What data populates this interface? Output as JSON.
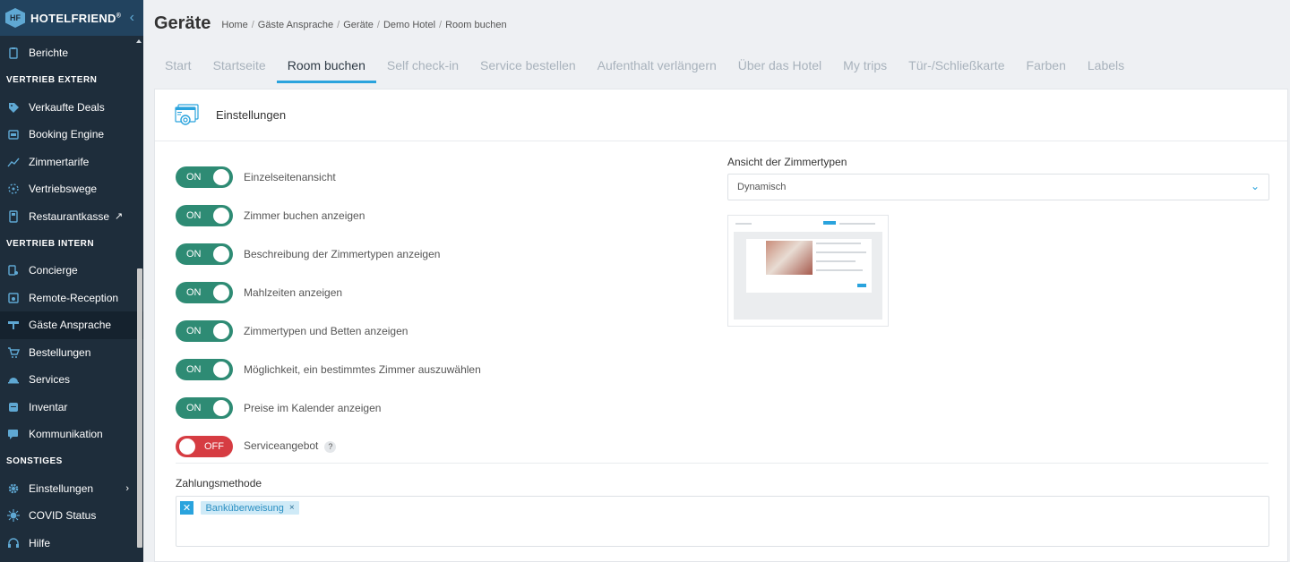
{
  "brand": {
    "name": "HOTELFRIEND",
    "trademark": "®",
    "logo_text": "HF"
  },
  "sidebar": {
    "top_items": [
      {
        "label": "Berichte",
        "icon": "clipboard-icon"
      }
    ],
    "sections": [
      {
        "title": "VERTRIEB EXTERN",
        "items": [
          {
            "label": "Verkaufte Deals",
            "icon": "tag-icon"
          },
          {
            "label": "Booking Engine",
            "icon": "booking-icon"
          },
          {
            "label": "Zimmertarife",
            "icon": "chart-line-icon"
          },
          {
            "label": "Vertriebswege",
            "icon": "channels-icon"
          },
          {
            "label": "Restaurantkasse",
            "icon": "pos-icon",
            "external": true
          }
        ]
      },
      {
        "title": "VERTRIEB INTERN",
        "items": [
          {
            "label": "Concierge",
            "icon": "concierge-icon"
          },
          {
            "label": "Remote-Reception",
            "icon": "reception-icon"
          },
          {
            "label": "Gäste Ansprache",
            "icon": "guest-icon",
            "active": true
          },
          {
            "label": "Bestellungen",
            "icon": "cart-icon"
          },
          {
            "label": "Services",
            "icon": "cloche-icon"
          },
          {
            "label": "Inventar",
            "icon": "inventory-icon"
          },
          {
            "label": "Kommunikation",
            "icon": "chat-icon"
          }
        ]
      },
      {
        "title": "SONSTIGES",
        "items": [
          {
            "label": "Einstellungen",
            "icon": "gear-icon",
            "has_submenu": true
          },
          {
            "label": "COVID Status",
            "icon": "virus-icon"
          },
          {
            "label": "Hilfe",
            "icon": "headset-icon"
          }
        ]
      }
    ]
  },
  "header": {
    "title": "Geräte",
    "breadcrumb": [
      "Home",
      "Gäste Ansprache",
      "Geräte",
      "Demo Hotel",
      "Room buchen"
    ]
  },
  "tabs": [
    "Start",
    "Startseite",
    "Room buchen",
    "Self check-in",
    "Service bestellen",
    "Aufenthalt verlängern",
    "Über das Hotel",
    "My trips",
    "Tür-/Schließkarte",
    "Farben",
    "Labels"
  ],
  "active_tab": "Room buchen",
  "panel": {
    "title": "Einstellungen",
    "toggles": [
      {
        "label": "Einzelseitenansicht",
        "state": "ON"
      },
      {
        "label": "Zimmer buchen anzeigen",
        "state": "ON"
      },
      {
        "label": "Beschreibung der Zimmertypen anzeigen",
        "state": "ON"
      },
      {
        "label": "Mahlzeiten anzeigen",
        "state": "ON"
      },
      {
        "label": "Zimmertypen und Betten anzeigen",
        "state": "ON"
      },
      {
        "label": "Möglichkeit, ein bestimmtes Zimmer auszuwählen",
        "state": "ON"
      },
      {
        "label": "Preise im Kalender anzeigen",
        "state": "ON"
      },
      {
        "label": "Serviceangebot",
        "state": "OFF",
        "help": "?"
      }
    ],
    "room_view": {
      "label": "Ansicht der Zimmertypen",
      "value": "Dynamisch"
    },
    "payment": {
      "label": "Zahlungsmethode",
      "tags": [
        "Banküberweisung"
      ],
      "remove_symbol": "×",
      "clear_symbol": "✕"
    }
  },
  "colors": {
    "sidebar_bg": "#1e2d3b",
    "accent": "#2aa3dd",
    "on": "#2e8b74",
    "off": "#d63c42"
  }
}
